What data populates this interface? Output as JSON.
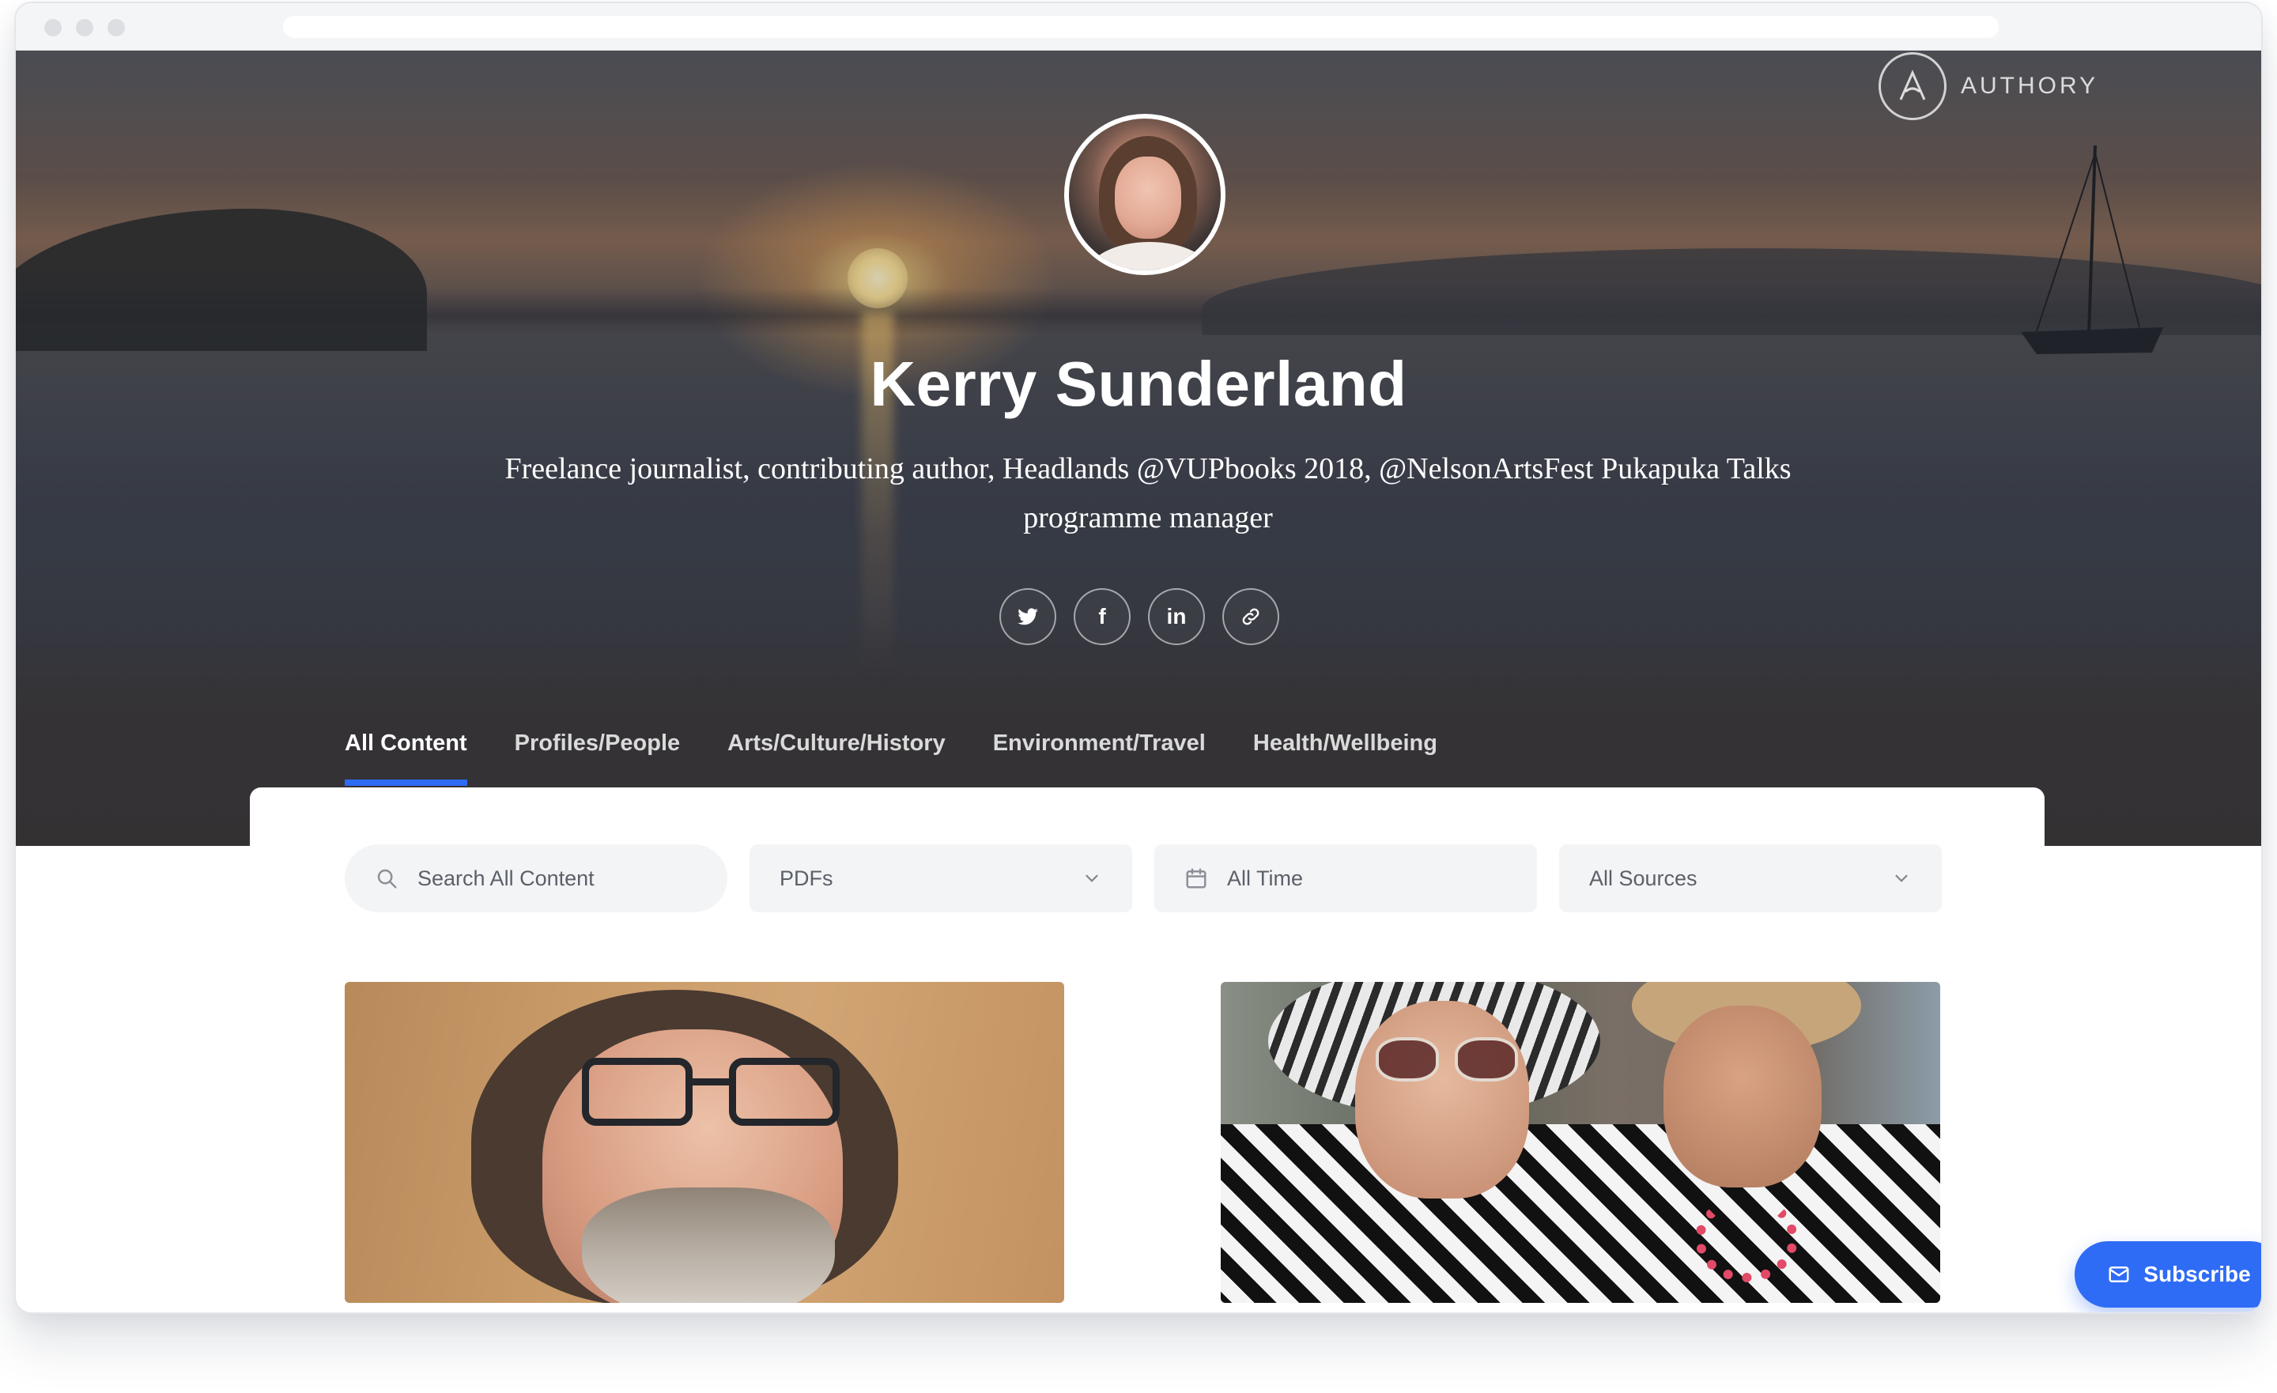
{
  "brand": {
    "logo_text": "AUTHORY",
    "logo_icon": "authory-a-logo-icon"
  },
  "profile": {
    "name": "Kerry Sunderland",
    "bio": "Freelance journalist, contributing author, Headlands @VUPbooks 2018, @NelsonArtsFest Pukapuka Talks programme manager",
    "avatar_icon": "profile-avatar"
  },
  "socials": [
    {
      "name": "twitter",
      "icon": "twitter-icon"
    },
    {
      "name": "facebook",
      "icon": "facebook-icon",
      "glyph": "f"
    },
    {
      "name": "linkedin",
      "icon": "linkedin-icon",
      "glyph": "in"
    },
    {
      "name": "website",
      "icon": "link-icon"
    }
  ],
  "tabs": [
    {
      "label": "All Content",
      "active": true
    },
    {
      "label": "Profiles/People",
      "active": false
    },
    {
      "label": "Arts/Culture/History",
      "active": false
    },
    {
      "label": "Environment/Travel",
      "active": false
    },
    {
      "label": "Health/Wellbeing",
      "active": false
    }
  ],
  "filters": {
    "search_placeholder": "Search All Content",
    "type_value": "PDFs",
    "time_value": "All Time",
    "source_value": "All Sources"
  },
  "actions": {
    "subscribe_label": "Subscribe"
  },
  "colors": {
    "accent": "#2f6cf5",
    "filter_bg": "#f3f4f6"
  }
}
